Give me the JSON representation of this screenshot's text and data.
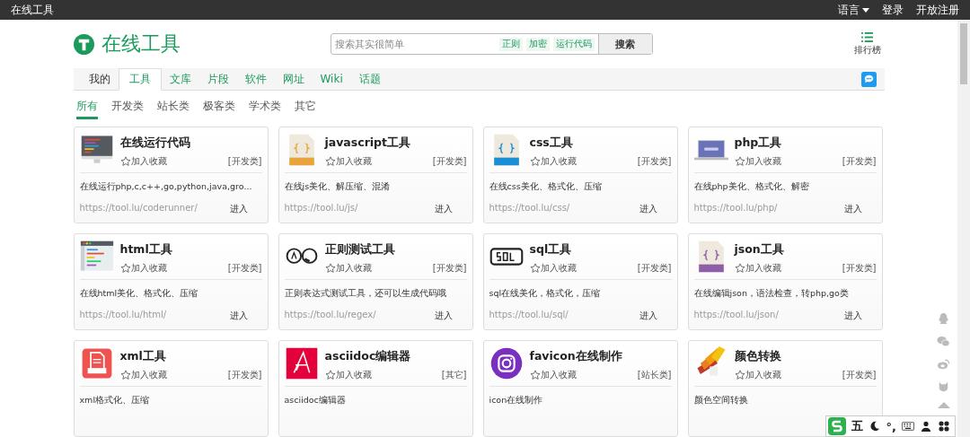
{
  "top_bar": {
    "title": "在线工具",
    "links": [
      {
        "label": "语言",
        "dropdown": true
      },
      {
        "label": "登录",
        "dropdown": false
      },
      {
        "label": "开放注册",
        "dropdown": false
      }
    ]
  },
  "header": {
    "logo_text": "在线工具",
    "search": {
      "placeholder": "搜索其实很简单",
      "tags": [
        "正则",
        "加密",
        "运行代码"
      ],
      "button": "搜索"
    },
    "ranking": "排行榜"
  },
  "tabs": [
    {
      "label": "我的",
      "selected": false
    },
    {
      "label": "工具",
      "selected": true
    },
    {
      "label": "文库",
      "selected": false
    },
    {
      "label": "片段",
      "selected": false
    },
    {
      "label": "软件",
      "selected": false
    },
    {
      "label": "网址",
      "selected": false
    },
    {
      "label": "Wiki",
      "selected": false
    },
    {
      "label": "话题",
      "selected": false
    }
  ],
  "categories": [
    {
      "label": "所有",
      "selected": true
    },
    {
      "label": "开发类",
      "selected": false
    },
    {
      "label": "站长类",
      "selected": false
    },
    {
      "label": "极客类",
      "selected": false
    },
    {
      "label": "学术类",
      "selected": false
    },
    {
      "label": "其它",
      "selected": false
    }
  ],
  "tools": [
    {
      "title": "在线运行代码",
      "favorite": "加入收藏",
      "category": "[开发类]",
      "description": "在线运行php,c,c++,go,python,java,gro...",
      "url": "https://tool.lu/coderunner/",
      "action": "进入"
    },
    {
      "title": "javascript工具",
      "favorite": "加入收藏",
      "category": "[开发类]",
      "description": "在线js美化、解压缩、混淆",
      "url": "https://tool.lu/js/",
      "action": "进入"
    },
    {
      "title": "css工具",
      "favorite": "加入收藏",
      "category": "[开发类]",
      "description": "在线css美化、格式化、压缩",
      "url": "https://tool.lu/css/",
      "action": "进入"
    },
    {
      "title": "php工具",
      "favorite": "加入收藏",
      "category": "[开发类]",
      "description": "在线php美化、格式化、解密",
      "url": "https://tool.lu/php/",
      "action": "进入"
    },
    {
      "title": "html工具",
      "favorite": "加入收藏",
      "category": "[开发类]",
      "description": "在线html美化、格式化、压缩",
      "url": "https://tool.lu/html/",
      "action": "进入"
    },
    {
      "title": "正则测试工具",
      "favorite": "加入收藏",
      "category": "[开发类]",
      "description": "正则表达式测试工具，还可以生成代码哦",
      "url": "https://tool.lu/regex/",
      "action": "进入"
    },
    {
      "title": "sql工具",
      "favorite": "加入收藏",
      "category": "[开发类]",
      "description": "sql在线美化，格式化，压缩",
      "url": "https://tool.lu/sql/",
      "action": "进入"
    },
    {
      "title": "json工具",
      "favorite": "加入收藏",
      "category": "[开发类]",
      "description": "在线编辑json，语法检查，转php,go类",
      "url": "https://tool.lu/json/",
      "action": "进入"
    },
    {
      "title": "xml工具",
      "favorite": "加入收藏",
      "category": "[开发类]",
      "description": "xml格式化、压缩"
    },
    {
      "title": "asciidoc编辑器",
      "favorite": "加入收藏",
      "category": "[其它]",
      "description": "asciidoc编辑器"
    },
    {
      "title": "favicon在线制作",
      "favorite": "加入收藏",
      "category": "[站长类]",
      "description": "icon在线制作"
    },
    {
      "title": "颜色转换",
      "favorite": "加入收藏",
      "category": "[开发类]",
      "description": "颜色空间转换"
    }
  ],
  "ime_bar": {
    "mode": "五",
    "punct": "°,"
  }
}
